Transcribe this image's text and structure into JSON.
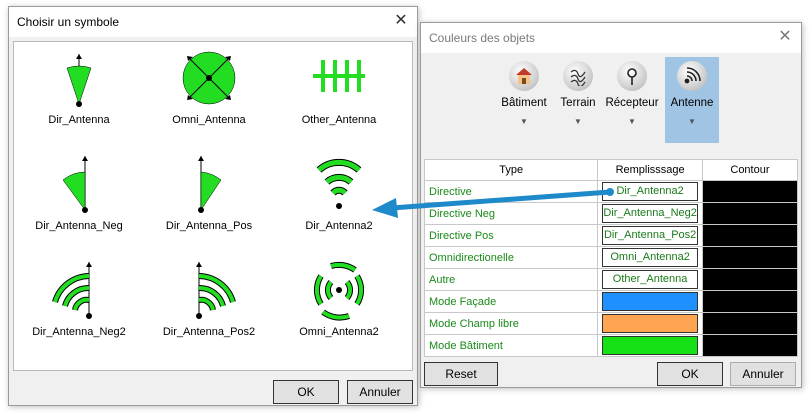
{
  "symbol_dialog": {
    "title": "Choisir un symbole",
    "symbols": [
      {
        "label": "Dir_Antenna",
        "icon": "dir-antenna-icon"
      },
      {
        "label": "Omni_Antenna",
        "icon": "omni-antenna-icon"
      },
      {
        "label": "Other_Antenna",
        "icon": "other-antenna-icon"
      },
      {
        "label": "Dir_Antenna_Neg",
        "icon": "dir-antenna-neg-icon"
      },
      {
        "label": "Dir_Antenna_Pos",
        "icon": "dir-antenna-pos-icon"
      },
      {
        "label": "Dir_Antenna2",
        "icon": "dir-antenna2-icon"
      },
      {
        "label": "Dir_Antenna_Neg2",
        "icon": "dir-antenna-neg2-icon"
      },
      {
        "label": "Dir_Antenna_Pos2",
        "icon": "dir-antenna-pos2-icon"
      },
      {
        "label": "Omni_Antenna2",
        "icon": "omni-antenna2-icon"
      }
    ],
    "ok_label": "OK",
    "cancel_label": "Annuler"
  },
  "colors_dialog": {
    "title": "Couleurs des objets",
    "ribbon": [
      {
        "label": "Bâtiment",
        "icon": "building-icon",
        "selected": false
      },
      {
        "label": "Terrain",
        "icon": "terrain-icon",
        "selected": false
      },
      {
        "label": "Récepteur",
        "icon": "receiver-icon",
        "selected": false
      },
      {
        "label": "Antenne",
        "icon": "antenna-icon",
        "selected": true
      }
    ],
    "table": {
      "headers": [
        "Type",
        "Remplisssage",
        "Contour"
      ],
      "rows": [
        {
          "type": "Directive",
          "fill": "Dir_Antenna2",
          "fill_color": "#ffffff",
          "contour_color": "#000000"
        },
        {
          "type": "Directive Neg",
          "fill": "Dir_Antenna_Neg2",
          "fill_color": "#ffffff",
          "contour_color": "#000000"
        },
        {
          "type": "Directive Pos",
          "fill": "Dir_Antenna_Pos2",
          "fill_color": "#ffffff",
          "contour_color": "#000000"
        },
        {
          "type": "Omnidirectionelle",
          "fill": "Omni_Antenna2",
          "fill_color": "#ffffff",
          "contour_color": "#000000"
        },
        {
          "type": "Autre",
          "fill": "Other_Antenna",
          "fill_color": "#ffffff",
          "contour_color": "#000000"
        },
        {
          "type": "Mode Façade",
          "fill": "",
          "fill_color": "#1e90ff",
          "contour_color": "#000000"
        },
        {
          "type": "Mode Champ libre",
          "fill": "",
          "fill_color": "#ffa552",
          "contour_color": "#000000"
        },
        {
          "type": "Mode Bâtiment",
          "fill": "",
          "fill_color": "#16e016",
          "contour_color": "#000000"
        }
      ]
    },
    "reset_label": "Reset",
    "ok_label": "OK",
    "cancel_label": "Annuler"
  },
  "colors": {
    "accent": "#0078d7",
    "arrow": "#1f8ac9",
    "symbol_green": "#22dd22",
    "type_text": "#1a8a1a"
  }
}
